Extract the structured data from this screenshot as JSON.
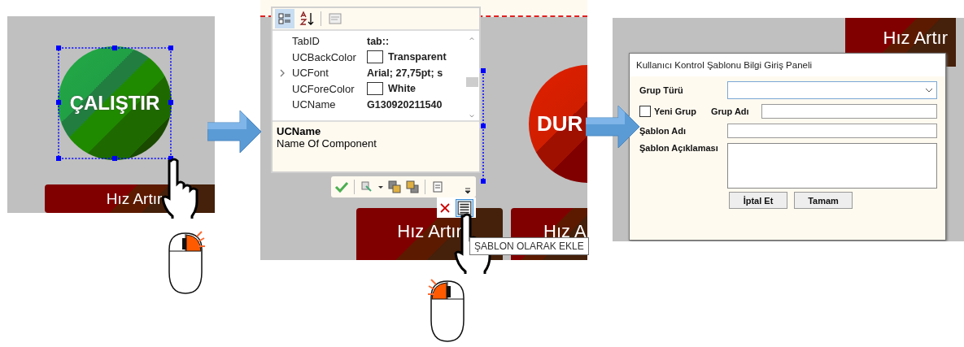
{
  "step1": {
    "circle_label": "ÇALIŞTIR",
    "button_label": "Hız Artır"
  },
  "property_grid": {
    "rows": [
      {
        "name": "TabID",
        "value": "tab::",
        "kind": "text",
        "expandable": false
      },
      {
        "name": "UCBackColor",
        "value": "Transparent",
        "kind": "color",
        "expandable": false
      },
      {
        "name": "UCFont",
        "value": "Arial; 27,75pt; s",
        "kind": "text",
        "expandable": true
      },
      {
        "name": "UCForeColor",
        "value": "White",
        "kind": "color",
        "expandable": false
      },
      {
        "name": "UCName",
        "value": "G130920211540",
        "kind": "text",
        "expandable": false
      }
    ],
    "description_title": "UCName",
    "description": "Name Of Component"
  },
  "step2": {
    "circle_label": "DUR",
    "buttons": [
      "Hız Artır",
      "Hız A"
    ],
    "tooltip": "ŞABLON OLARAK EKLE"
  },
  "step3": {
    "background_button": "Hız Artır"
  },
  "dialog": {
    "title": "Kullanıcı Kontrol Şablonu Bilgi Giriş Paneli",
    "group_type_label": "Grup Türü",
    "new_group": {
      "label": "Yeni Grup",
      "checked": false
    },
    "group_name_label": "Grup Adı",
    "template_name_label": "Şablon Adı",
    "template_description_label": "Şablon Açıklaması",
    "buttons": [
      "İptal Et",
      "Tamam"
    ]
  }
}
